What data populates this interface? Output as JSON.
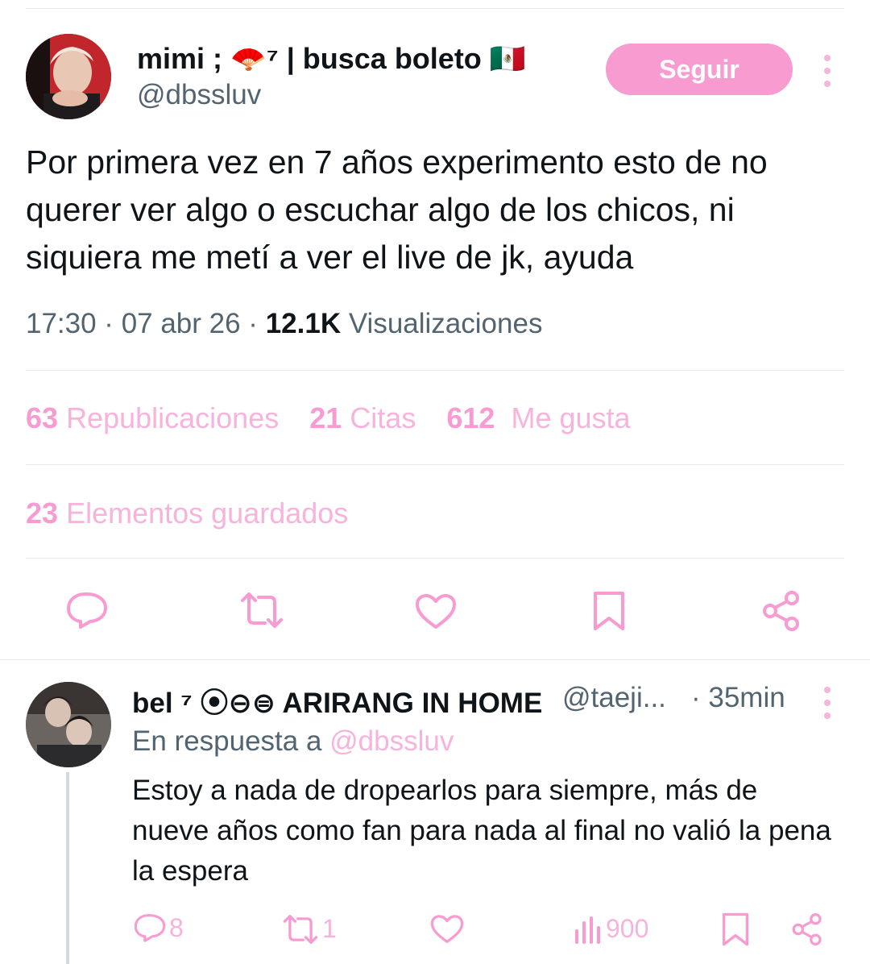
{
  "main_tweet": {
    "name": "mimi ; 🪭⁷ | busca boleto 🇲🇽",
    "handle": "@dbssluv",
    "follow_label": "Seguir",
    "text": "Por primera vez en 7 años experimento esto de no querer ver algo o escuchar algo de los chicos, ni siquiera me metí a ver el live de jk, ayuda",
    "time": "17:30 · 07 abr 26 · ",
    "views_count": "12.1K",
    "views_label": " Visualizaciones",
    "stats": {
      "reposts_count": "63",
      "reposts_label": "Republicaciones",
      "quotes_count": "21",
      "quotes_label": "Citas",
      "likes_count": "612",
      "likes_label": "Me gusta",
      "saved_count": "23",
      "saved_label": "Elementos guardados"
    },
    "actions": [
      "reply-icon",
      "repost-icon",
      "like-icon",
      "bookmark-icon",
      "share-icon"
    ]
  },
  "reply": {
    "name": "bel ⁷ ⦿⊖⊜ ARIRANG IN HOME",
    "handle": "@taeji...",
    "time": "· 35min",
    "reply_prefix": "En respuesta a ",
    "reply_mention": "@dbssluv",
    "text": "Estoy a nada de dropearlos para siempre, más de nueve años como fan para nada al final no valió la pena la espera",
    "counts": {
      "replies": "8",
      "reposts": "1",
      "views": "900"
    }
  },
  "colors": {
    "accent": "#f79bd1",
    "accent_light": "#f7b3da",
    "secondary_text": "#536471"
  }
}
